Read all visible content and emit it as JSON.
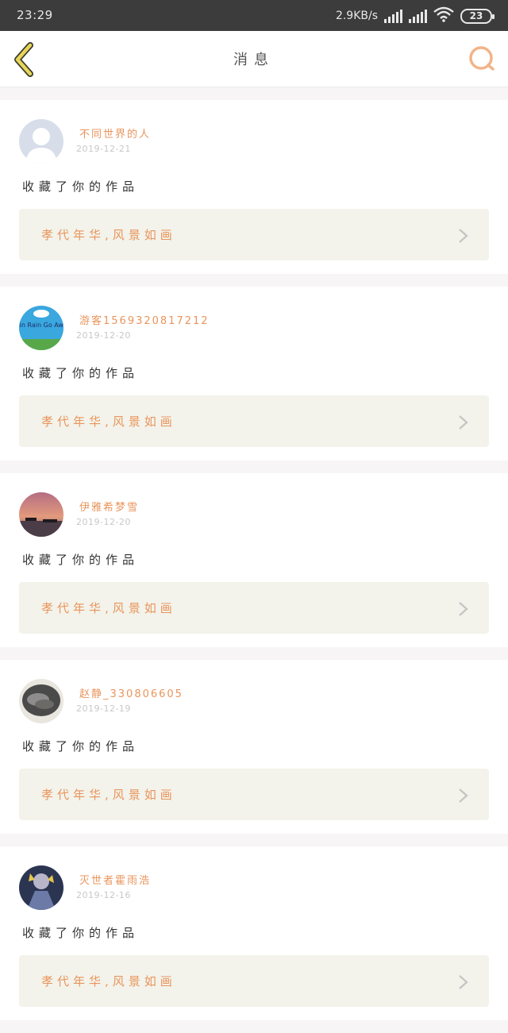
{
  "status_bar": {
    "time": "23:29",
    "network_speed": "2.9KB/s",
    "battery": "23"
  },
  "header": {
    "title": "消息",
    "back_icon": "chevron-left-icon",
    "search_icon": "search-icon"
  },
  "colors": {
    "accent": "#e9955c",
    "back_icon": "#d8c23a",
    "link_bg": "#f3f3eb"
  },
  "messages": [
    {
      "username": "不同世界的人",
      "date": "2019-12-21",
      "action": "收藏了你的作品",
      "work_title": "孝代年华,风景如画",
      "avatar": "default-person-avatar"
    },
    {
      "username": "游客15693208172​12",
      "date": "2019-12-20",
      "action": "收藏了你的作品",
      "work_title": "孝代年华,风景如画",
      "avatar": "rain-cloud-avatar",
      "avatar_text": "Rain Rain Go Away"
    },
    {
      "username": "伊雅希梦雪",
      "date": "2019-12-20",
      "action": "收藏了你的作品",
      "work_title": "孝代年华,风景如画",
      "avatar": "sunset-sea-avatar"
    },
    {
      "username": "赵静_330806605",
      "date": "2019-12-19",
      "action": "收藏了你的作品",
      "work_title": "孝代年华,风景如画",
      "avatar": "photo-avatar"
    },
    {
      "username": "灭世者霍雨浩",
      "date": "2019-12-16",
      "action": "收藏了你的作品",
      "work_title": "孝代年华,风景如画",
      "avatar": "anime-avatar"
    }
  ]
}
